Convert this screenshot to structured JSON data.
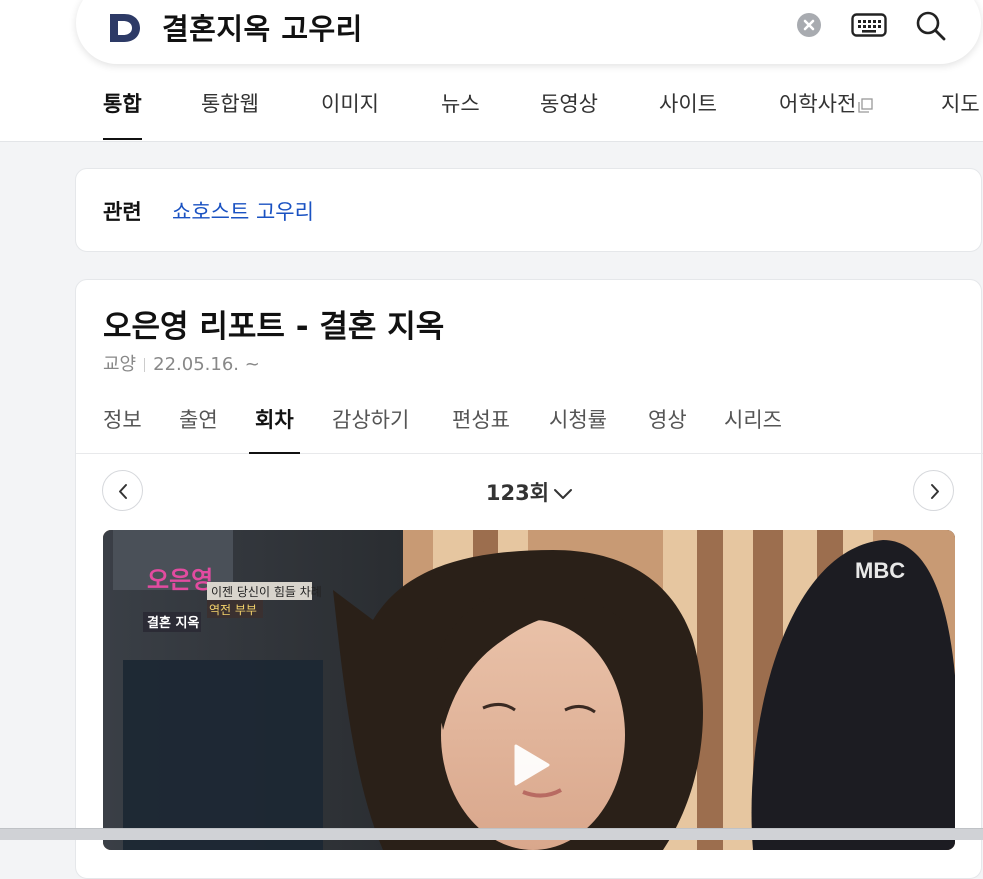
{
  "search": {
    "query": "결혼지옥 고우리",
    "logo_letter": "D"
  },
  "icons": {
    "clear": "clear-icon",
    "keyboard": "keyboard-icon",
    "search": "search-icon",
    "external": "external-window-icon",
    "prev": "chevron-left-icon",
    "next": "chevron-right-icon",
    "dropdown": "chevron-down-icon",
    "play": "play-icon"
  },
  "tabs": [
    {
      "label": "통합",
      "active": true
    },
    {
      "label": "통합웹"
    },
    {
      "label": "이미지"
    },
    {
      "label": "뉴스"
    },
    {
      "label": "동영상"
    },
    {
      "label": "사이트"
    },
    {
      "label": "어학사전"
    },
    {
      "label": "지도"
    }
  ],
  "related": {
    "label": "관련",
    "link": "쇼호스트 고우리"
  },
  "program": {
    "title": "오은영 리포트 - 결혼 지옥",
    "genre": "교양",
    "date": "22.05.16. ~",
    "sub_tabs": [
      {
        "label": "정보"
      },
      {
        "label": "출연"
      },
      {
        "label": "회차",
        "active": true
      },
      {
        "label": "감상하기"
      },
      {
        "label": "편성표"
      },
      {
        "label": "시청률"
      },
      {
        "label": "영상"
      },
      {
        "label": "시리즈"
      }
    ],
    "episode": "123회",
    "video": {
      "broadcaster": "MBC",
      "logo_text": "오은영",
      "caption_1": "이젠 당신이 힘들 차례",
      "caption_2": "역전 부부",
      "caption_3": "결혼 지옥"
    }
  },
  "colors": {
    "link": "#1a52c2",
    "logo": "#2d3a66"
  }
}
